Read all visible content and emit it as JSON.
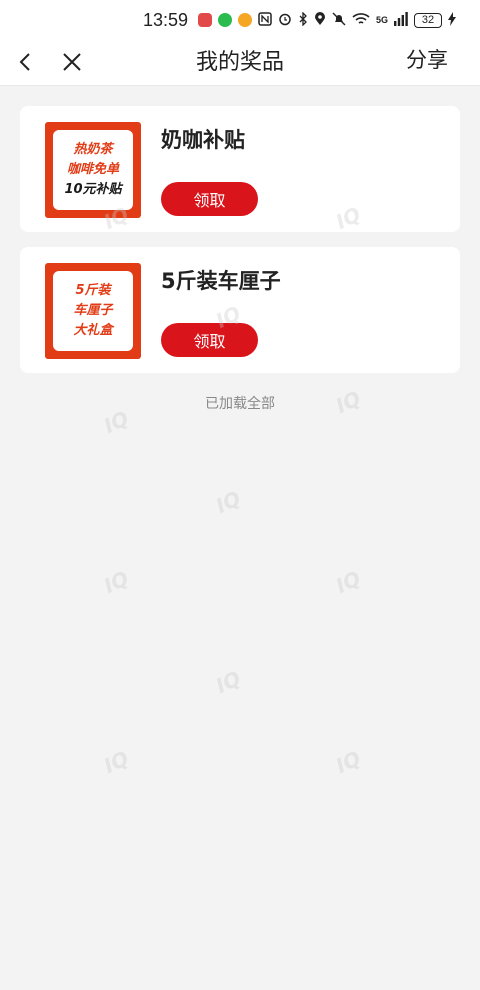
{
  "status_bar": {
    "time": "13:59",
    "network": "5G",
    "battery": "32",
    "icons": [
      "app-icon-red",
      "wechat-icon",
      "weibo-icon",
      "nfc-icon",
      "alarm-icon",
      "bluetooth-icon",
      "location-icon",
      "mute-icon",
      "wifi-icon",
      "signal-icon",
      "charging-icon"
    ]
  },
  "header": {
    "title": "我的奖品",
    "share_label": "分享",
    "back_icon": "chevron-left-icon",
    "close_icon": "close-icon"
  },
  "prizes": [
    {
      "title": "奶咖补贴",
      "thumb_lines": [
        "热奶茶",
        "咖啡免单",
        "10元补贴"
      ],
      "button_label": "领取"
    },
    {
      "title": "5斤装车厘子",
      "thumb_lines": [
        "5斤装",
        "车厘子",
        "大礼盒"
      ],
      "button_label": "领取"
    }
  ],
  "footer_text": "已加载全部",
  "watermark": "IQ"
}
